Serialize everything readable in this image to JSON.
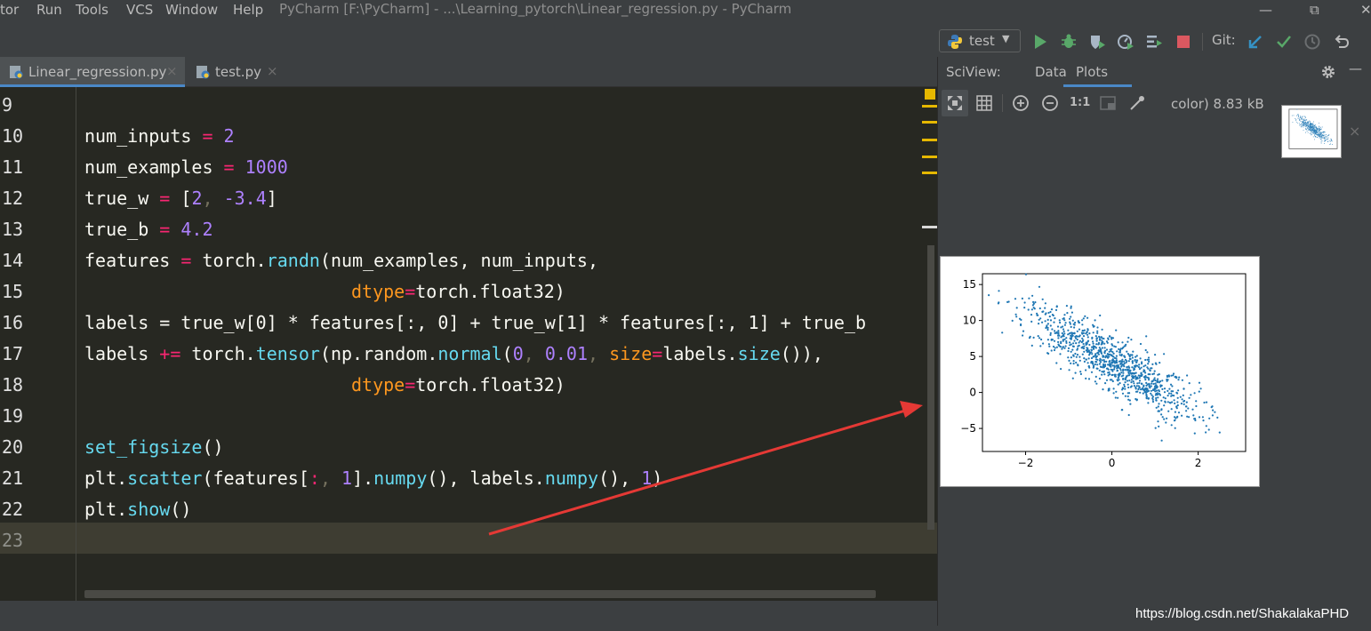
{
  "menu": {
    "items": [
      {
        "label": "tor"
      },
      {
        "label": "Run"
      },
      {
        "label": "Tools"
      },
      {
        "label": "VCS"
      },
      {
        "label": "Window"
      },
      {
        "label": "Help"
      }
    ],
    "window_title": "PyCharm [F:\\PyCharm] - ...\\Learning_pytorch\\Linear_regression.py - PyCharm"
  },
  "window_controls": {
    "minimize": "—",
    "restore": "⧉",
    "close": "✕"
  },
  "toolbar": {
    "run_config": "test",
    "run_config_icon": "python-icon",
    "git_label": "Git:",
    "icons": [
      "run-icon",
      "debug-icon",
      "coverage-icon",
      "profile-icon",
      "concurrency-icon",
      "stop-icon",
      "git-update-icon",
      "git-commit-icon",
      "git-history-icon",
      "git-revert-icon"
    ],
    "colors": {
      "run": "#59a869",
      "stop": "#db5860",
      "git_update": "#3592c4",
      "git_commit": "#59a869"
    }
  },
  "editor_tabs": [
    {
      "name": "Linear_regression.py",
      "active": true
    },
    {
      "name": "test.py",
      "active": false
    }
  ],
  "editor": {
    "lines": [
      {
        "num": "9"
      },
      {
        "num": "10"
      },
      {
        "num": "11"
      },
      {
        "num": "12"
      },
      {
        "num": "13"
      },
      {
        "num": "14"
      },
      {
        "num": "15"
      },
      {
        "num": "16"
      },
      {
        "num": "17"
      },
      {
        "num": "18"
      },
      {
        "num": "19"
      },
      {
        "num": "20"
      },
      {
        "num": "21"
      },
      {
        "num": "22"
      },
      {
        "num": "23"
      }
    ],
    "code": {
      "l10": {
        "a": "num_inputs ",
        "op": "=",
        "b": " ",
        "n": "2"
      },
      "l11": {
        "a": "num_examples ",
        "op": "=",
        "b": " ",
        "n": "1000"
      },
      "l12": {
        "a": "true_w ",
        "op": "=",
        "b": " [",
        "n1": "2",
        "c": ",",
        "d": " ",
        "n2": "-3.4",
        "e": "]"
      },
      "l13": {
        "a": "true_b ",
        "op": "=",
        "b": " ",
        "n": "4.2"
      },
      "l14": {
        "a": "features ",
        "op": "=",
        "b": " torch.",
        "fn": "randn",
        "c": "(num_examples, num_inputs,"
      },
      "l15": {
        "kw": "dtype",
        "op": "=",
        "c": "torch.float32)"
      },
      "l16": {
        "text": "labels = true_w[0] * features[:, 0] + true_w[1] * features[:, 1] + true_b"
      },
      "l17": {
        "a": "labels ",
        "op": "+=",
        "b": " torch.",
        "fn1": "tensor",
        "c": "(np.random.",
        "fn2": "normal",
        "d": "(",
        "n1": "0",
        "e": ", ",
        "n2": "0.01",
        "f": ", ",
        "kw": "size",
        "op2": "=",
        "g": "labels.",
        "fn3": "size",
        "h": "()),"
      },
      "l18": {
        "kw": "dtype",
        "op": "=",
        "c": "torch.float32)"
      },
      "l20": {
        "fn": "set_figsize",
        "c": "()"
      },
      "l21": {
        "a": "plt.",
        "fn1": "scatter",
        "b": "(features[",
        "d": ":",
        "e": ", ",
        "n1": "1",
        "f": "].",
        "fn2": "numpy",
        "g": "(), labels.",
        "fn3": "numpy",
        "h": "(), ",
        "n2": "1",
        "i": ")"
      },
      "l22": {
        "a": "plt.",
        "fn": "show",
        "b": "()"
      }
    }
  },
  "sciview": {
    "title": "SciView:",
    "tabs": [
      {
        "label": "Data"
      },
      {
        "label": "Plots",
        "active": true
      }
    ],
    "info": "color) 8.83 kB",
    "toolbar_icons": [
      "fit-icon",
      "grid-icon",
      "zoom-in-icon",
      "zoom-out-icon",
      "actual-size-icon",
      "background-icon",
      "color-picker-icon"
    ],
    "actual_size_label": "1:1"
  },
  "chart_data": {
    "type": "scatter",
    "title": "",
    "xlabel": "",
    "ylabel": "",
    "xlim": [
      -3.0,
      3.1
    ],
    "ylim": [
      -8.2,
      16.5
    ],
    "xticks": [
      -2,
      0,
      2
    ],
    "yticks": [
      -5,
      0,
      5,
      10,
      15
    ],
    "xtick_labels": [
      "−2",
      "0",
      "2"
    ],
    "ytick_labels": [
      "−5",
      "0",
      "5",
      "10",
      "15"
    ],
    "color": "#1f77b4",
    "model": {
      "intercept": 4.2,
      "slope": -3.4,
      "n_points": 1000
    }
  },
  "watermark": "https://blog.csdn.net/ShakalakaPHD",
  "annotation": {
    "color": "#e53935"
  }
}
